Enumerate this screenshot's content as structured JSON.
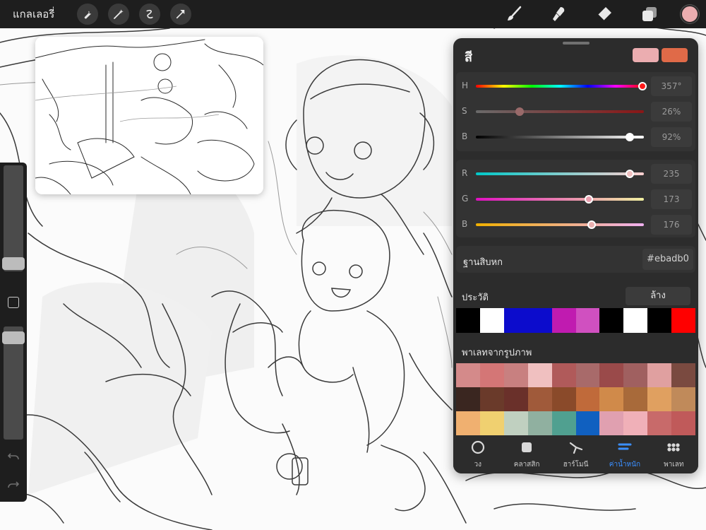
{
  "topbar": {
    "gallery_label": "แกลเลอรี่",
    "left_tools": [
      "wrench-icon",
      "magic-wand-icon",
      "selection-icon",
      "transform-icon"
    ],
    "right_tools": [
      "brush-icon",
      "smudge-icon",
      "eraser-icon",
      "layers-icon"
    ],
    "current_color": "#ebadb0"
  },
  "sidebar": {
    "size_slider_value": 0.37,
    "opacity_slider_value": 0.05
  },
  "color_panel": {
    "title": "สี",
    "primary_color": "#ebadb0",
    "secondary_color": "#e06a48",
    "hsb": [
      {
        "letter": "H",
        "value": "357°"
      },
      {
        "letter": "S",
        "value": "26%"
      },
      {
        "letter": "B",
        "value": "92%"
      }
    ],
    "rgb": [
      {
        "letter": "R",
        "value": "235"
      },
      {
        "letter": "G",
        "value": "173"
      },
      {
        "letter": "B",
        "value": "176"
      }
    ],
    "hex_label": "ฐานสิบหก",
    "hex_value": "#ebadb0",
    "history_label": "ประวัติ",
    "clear_label": "ล้าง",
    "history_colors": [
      "#000000",
      "#ffffff",
      "#0c0ccc",
      "#0c0ccc",
      "#c01bb0",
      "#d050c0",
      "#000000",
      "#ffffff",
      "#000000",
      "#ff0000"
    ],
    "palette_label": "พาเลทจากรูปภาพ",
    "palette_colors": [
      "#d48a8a",
      "#d47676",
      "#c88080",
      "#f0c0c0",
      "#b05a5a",
      "#a86a6a",
      "#9a4a4a",
      "#a06060",
      "#e0a0a0",
      "#7a4a40",
      "#3a2620",
      "#6a3a2a",
      "#6a302a",
      "#a05a3a",
      "#8a4a2a",
      "#c06a3a",
      "#d08a4a",
      "#a86a3a",
      "#e0a060",
      "#c08a5a",
      "#f0b070",
      "#f0d070",
      "#c0d0c0",
      "#90b0a0",
      "#50a090",
      "#1060c0",
      "#e0a0b0",
      "#f0b0b8",
      "#c86a6a",
      "#c05a5a"
    ],
    "tabs": [
      {
        "label": "วง",
        "icon": "disc-icon",
        "active": false
      },
      {
        "label": "คลาสสิก",
        "icon": "classic-square-icon",
        "active": false
      },
      {
        "label": "ฮาร์โมนี",
        "icon": "harmony-icon",
        "active": false
      },
      {
        "label": "ค่าน้ำหนัก",
        "icon": "value-sliders-icon",
        "active": true
      },
      {
        "label": "พาเลท",
        "icon": "palette-grid-icon",
        "active": false
      }
    ]
  }
}
